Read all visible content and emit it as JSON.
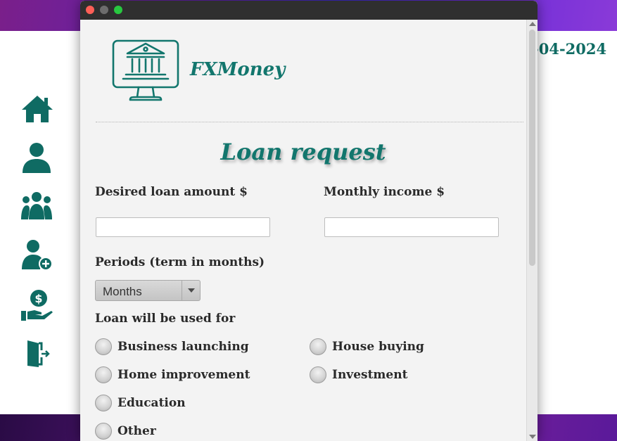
{
  "background_app": {
    "date_fragment": "-04-2024",
    "sidebar": [
      {
        "icon": "home-icon"
      },
      {
        "icon": "user-icon"
      },
      {
        "icon": "users-group-icon"
      },
      {
        "icon": "add-user-icon"
      },
      {
        "icon": "loan-money-hand-icon"
      },
      {
        "icon": "logout-icon"
      }
    ]
  },
  "modal": {
    "brand_name": "FXMoney",
    "heading": "Loan request",
    "loan_amount": {
      "label": "Desired loan amount $",
      "value": ""
    },
    "monthly_income": {
      "label": "Monthly income $",
      "value": ""
    },
    "period": {
      "label": "Periods (term in months)",
      "selected": "Months"
    },
    "purpose": {
      "label": "Loan will be used for",
      "options": [
        "Business launching",
        "House buying",
        "Home improvement",
        "Investment",
        "Education",
        "Other"
      ]
    }
  },
  "colors": {
    "accent": "#12766d",
    "titlebar": "#2f2f2f"
  }
}
